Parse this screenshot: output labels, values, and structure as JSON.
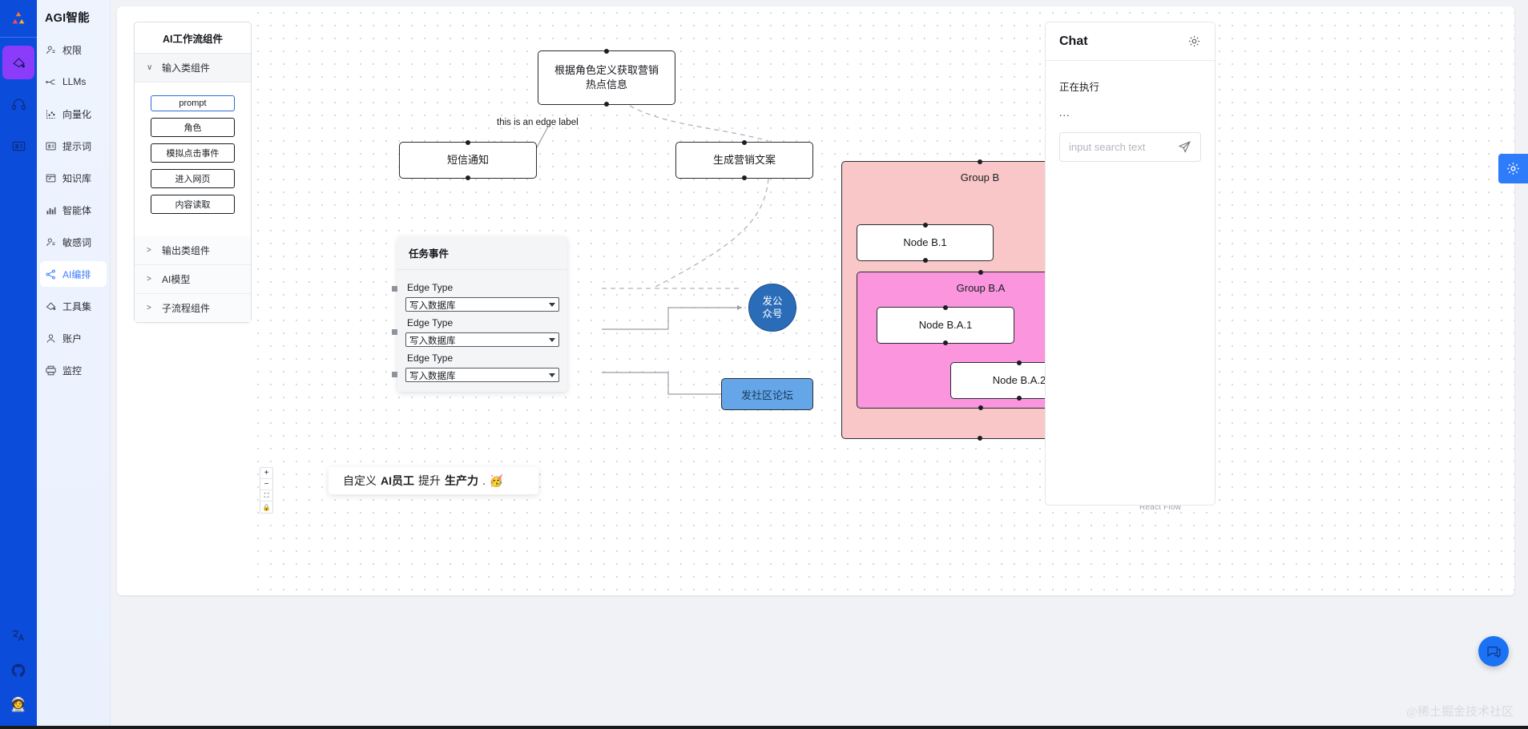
{
  "rail": {
    "logo_icon": "app-logo-icon",
    "items": [
      {
        "icon": "tools-icon",
        "active": true
      },
      {
        "icon": "headset-icon",
        "active": false
      },
      {
        "icon": "id-card-icon",
        "active": false
      }
    ],
    "bottom": [
      {
        "icon": "translate-icon"
      },
      {
        "icon": "github-icon"
      },
      {
        "icon": "astronaut-icon"
      }
    ]
  },
  "sidebar": {
    "title": "AGI智能",
    "items": [
      {
        "label": "权限",
        "icon": "user-permission-icon",
        "active": false
      },
      {
        "label": "LLMs",
        "icon": "llm-node-icon",
        "active": false
      },
      {
        "label": "向量化",
        "icon": "vector-chart-icon",
        "active": false
      },
      {
        "label": "提示词",
        "icon": "prompt-card-icon",
        "active": false
      },
      {
        "label": "知识库",
        "icon": "knowledge-base-icon",
        "active": false
      },
      {
        "label": "智能体",
        "icon": "agent-chart-icon",
        "active": false
      },
      {
        "label": "敏感词",
        "icon": "sensitive-word-icon",
        "active": false
      },
      {
        "label": "AI编排",
        "icon": "share-nodes-icon",
        "active": true
      },
      {
        "label": "工具集",
        "icon": "toolset-icon",
        "active": false
      },
      {
        "label": "账户",
        "icon": "account-icon",
        "active": false
      },
      {
        "label": "监控",
        "icon": "monitor-icon",
        "active": false
      }
    ]
  },
  "palette": {
    "title": "AI工作流组件",
    "sections": [
      {
        "label": "输入类组件",
        "expanded": true,
        "chevron": "chevron-down-icon",
        "chips": [
          {
            "label": "prompt",
            "selected": true
          },
          {
            "label": "角色",
            "selected": false
          },
          {
            "label": "模拟点击事件",
            "selected": false
          },
          {
            "label": "进入网页",
            "selected": false
          },
          {
            "label": "内容读取",
            "selected": false
          }
        ]
      },
      {
        "label": "输出类组件",
        "expanded": false,
        "chevron": "chevron-right-icon",
        "chips": []
      },
      {
        "label": "AI模型",
        "expanded": false,
        "chevron": "chevron-right-icon",
        "chips": []
      },
      {
        "label": "子流程组件",
        "expanded": false,
        "chevron": "chevron-right-icon",
        "chips": []
      }
    ]
  },
  "canvas": {
    "nodes": [
      {
        "id": "n1",
        "label": "根据角色定义获取营销热点信息",
        "type": "box"
      },
      {
        "id": "n2",
        "label": "短信通知",
        "type": "box"
      },
      {
        "id": "n3",
        "label": "生成营销文案",
        "type": "box"
      },
      {
        "id": "n4",
        "label": "发公众号",
        "type": "circle"
      },
      {
        "id": "n5",
        "label": "发社区论坛",
        "type": "blue-box"
      },
      {
        "id": "nb1",
        "label": "Node B.1",
        "type": "box"
      },
      {
        "id": "nba1",
        "label": "Node B.A.1",
        "type": "box"
      },
      {
        "id": "nba2",
        "label": "Node B.A.2",
        "type": "box"
      }
    ],
    "groups": [
      {
        "id": "gb",
        "label": "Group B",
        "color": "#f9c7c7"
      },
      {
        "id": "gba",
        "label": "Group B.A",
        "color": "#fa95de"
      }
    ],
    "edge_label": "this is an edge label",
    "watermark": "React Flow",
    "zoom_controls": [
      {
        "icon": "zoom-in-icon",
        "glyph": "+"
      },
      {
        "icon": "zoom-out-icon",
        "glyph": "−"
      },
      {
        "icon": "fit-view-icon",
        "glyph": "⛶"
      },
      {
        "icon": "lock-icon",
        "glyph": "🔒"
      }
    ]
  },
  "task_panel": {
    "title": "任务事件",
    "fields": [
      {
        "label": "Edge Type",
        "value": "写入数据库"
      },
      {
        "label": "Edge Type",
        "value": "写入数据库"
      },
      {
        "label": "Edge Type",
        "value": "写入数据库"
      }
    ],
    "select_icon": "chevron-down-icon"
  },
  "tipbar": {
    "prefix": "自定义",
    "bold1": "AI员工",
    "middle": "提升",
    "bold2": "生产力",
    "suffix": ".",
    "emoji": "🥳"
  },
  "chat": {
    "title": "Chat",
    "gear_icon": "gear-icon",
    "status": "正在执行",
    "dots": "...",
    "input_placeholder": "input search text",
    "send_icon": "send-plane-icon"
  },
  "floating": {
    "settings_icon": "gear-icon",
    "chat_bubble_icon": "chat-bubble-icon"
  },
  "watermark": "@稀土掘金技术社区",
  "colors": {
    "brand_blue": "#0c4cdb",
    "accent_purple": "#8b3cfb",
    "link_blue": "#3d7eff",
    "group_b": "#f9c7c7",
    "group_ba": "#fa95de",
    "circle_node": "#2b6cb8",
    "blue_node": "#64a6e8"
  }
}
